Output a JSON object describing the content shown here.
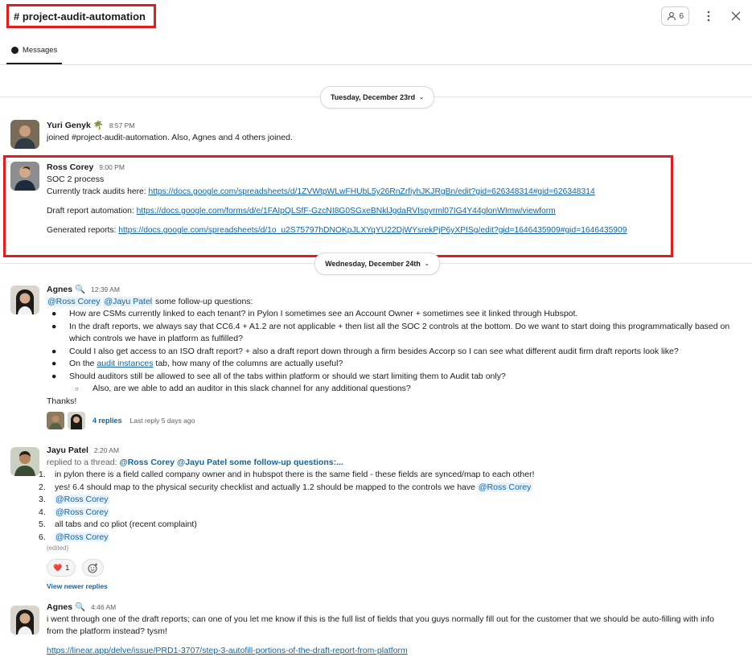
{
  "header": {
    "channel_name": "# project-audit-automation",
    "member_count": "6",
    "icons": [
      "person-icon",
      "more-vertical-icon",
      "close-icon"
    ]
  },
  "tabs": {
    "messages_label": "Messages"
  },
  "dates": {
    "first": "Tuesday, December 23rd",
    "second": "Wednesday, December 24th"
  },
  "messages": {
    "yuri": {
      "name": "Yuri Genyk",
      "emoji": "🌴",
      "time": "8:57 PM",
      "text": "joined #project-audit-automation. Also, Agnes and 4 others joined."
    },
    "ross": {
      "name": "Ross Corey",
      "time": "9:00 PM",
      "line1": "SOC 2 process",
      "track_label": "Currently track audits here: ",
      "track_link": "https://docs.google.com/spreadsheets/d/1ZVWtpWLwFHUbL5y26RnZrfiyhJKJRgBn/edit?gid=626348314#gid=626348314",
      "draft_label": "Draft report automation: ",
      "draft_link": "https://docs.google.com/forms/d/e/1FAIpQLSfF-GzcNI8G0SGxeBNklJgdaRVIspyrml07IG4Y44glonWImw/viewform",
      "generated_label": "Generated reports: ",
      "generated_link": "https://docs.google.com/spreadsheets/d/1o_u2S75797hDNOKpJLXYqYU22DjWYsrekPjP6yXPISg/edit?gid=1646435909#gid=1646435909"
    },
    "agnes1": {
      "name": "Agnes",
      "emoji": "🔍",
      "time": "12:39 AM",
      "mention1": "@Ross Corey",
      "mention2": "@Jayu Patel",
      "intro": " some follow-up questions:",
      "b1": "How are CSMs currently linked to each tenant? in Pylon I sometimes see an Account Owner + sometimes see it linked through Hubspot.",
      "b2a": "In the draft reports, we always say that CC6.4 + A1.2 are not applicable + then list all the SOC 2 controls at the bottom. Do we want to start doing this programmatically based on",
      "b2b": "which controls we have in platform as fulfilled?",
      "b3": "Could I also get access to an ISO draft report? + also a draft report down through a firm besides Accorp so I can see what different audit firm draft reports look like?",
      "b4_pre": "On the ",
      "b4_link": "audit instances",
      "b4_post": " tab, how many of the columns are actually useful?",
      "b5": "Should auditors still be allowed to see all of the tabs within platform or should we start limiting them to Audit tab only?",
      "b5_sub": "Also, are we able to add an auditor in this slack channel for any additional questions?",
      "thanks": "Thanks!",
      "replies": "4 replies",
      "last_reply": "Last reply 5 days ago"
    },
    "jayu": {
      "name": "Jayu Patel",
      "time": "2:20 AM",
      "replied_prefix": "replied to a thread: ",
      "replied_link": "@Ross Corey @Jayu Patel some follow-up questions:...",
      "n1": "in pylon there is a field called company owner and in hubspot there is the same field - these fields are synced/map to each other!",
      "n2": "yes! 6.4 should map to the physical security checklist and actually 1.2 should be mapped to the controls we have ",
      "n2_mention": "@Ross Corey",
      "n3": "@Ross Corey",
      "n4": "@Ross Corey",
      "n5": "all tabs and co pliot (recent complaint)",
      "n6": "@Ross Corey",
      "edited": "(edited)",
      "reaction_emoji": "❤️",
      "reaction_count": "1",
      "view_newer": "View newer replies"
    },
    "agnes2": {
      "name": "Agnes",
      "emoji": "🔍",
      "time": "4:46 AM",
      "l1": "i went through one of the draft reports; can one of you let me know if this is the full list of fields that you guys normally fill out for the customer that we should be auto-filling with info",
      "l2": "from the platform instead? tysm!",
      "link": "https://linear.app/delve/issue/PRD1-3707/step-3-autofill-portions-of-the-draft-report-from-platform"
    }
  },
  "colors": {
    "highlight": "#e01e1e",
    "link": "#1264a3"
  }
}
